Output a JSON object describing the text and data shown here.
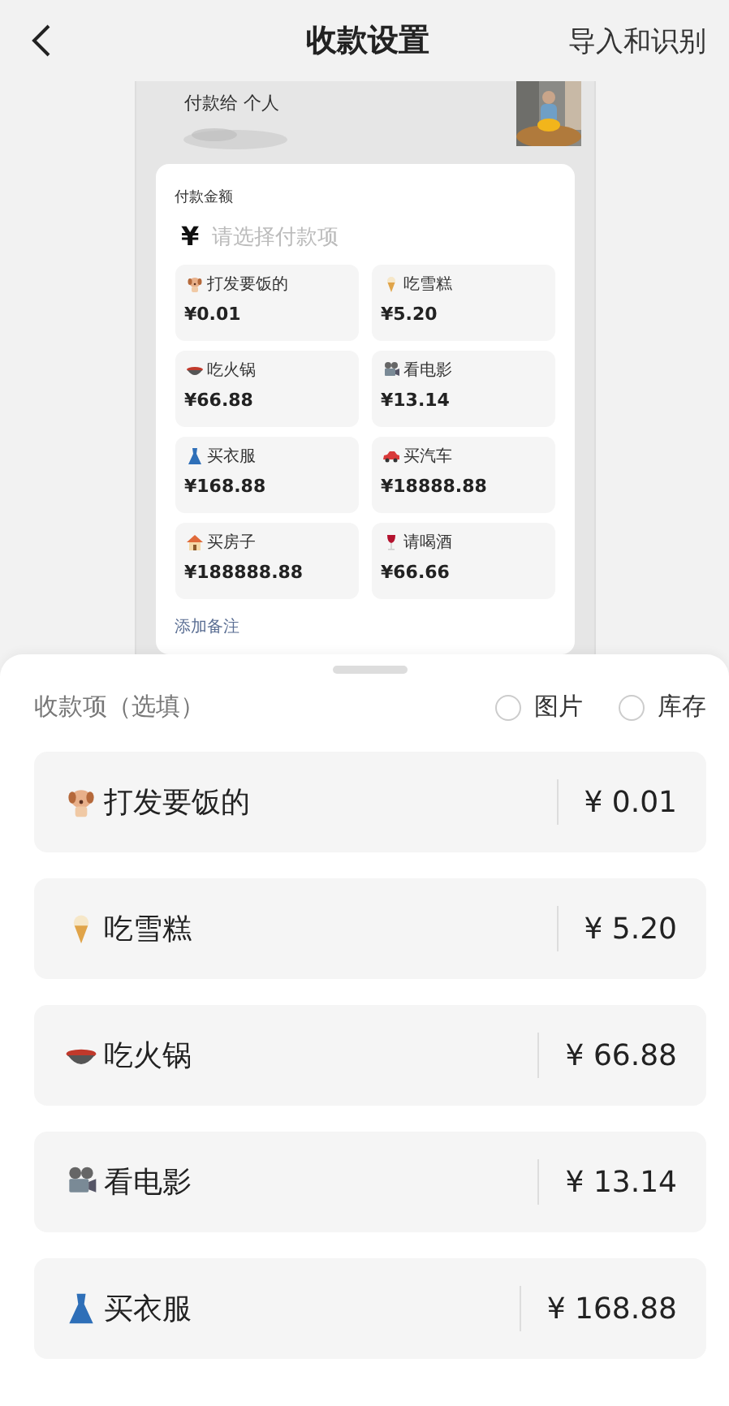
{
  "header": {
    "title": "收款设置",
    "action": "导入和识别"
  },
  "preview": {
    "payee": "付款给 个人",
    "amount_label": "付款金额",
    "currency": "¥",
    "amount_placeholder": "请选择付款项",
    "items": [
      {
        "kind": "dog",
        "name": "打发要饭的",
        "price": "¥0.01"
      },
      {
        "kind": "icecream",
        "name": "吃雪糕",
        "price": "¥5.20"
      },
      {
        "kind": "pot",
        "name": "吃火锅",
        "price": "¥66.88"
      },
      {
        "kind": "projector",
        "name": "看电影",
        "price": "¥13.14"
      },
      {
        "kind": "dress",
        "name": "买衣服",
        "price": "¥168.88"
      },
      {
        "kind": "car",
        "name": "买汽车",
        "price": "¥18888.88"
      },
      {
        "kind": "house",
        "name": "买房子",
        "price": "¥188888.88"
      },
      {
        "kind": "wine",
        "name": "请喝酒",
        "price": "¥66.66"
      }
    ],
    "add_note": "添加备注"
  },
  "sheet": {
    "title": "收款项（选填）",
    "options": [
      {
        "label": "图片",
        "checked": false
      },
      {
        "label": "库存",
        "checked": false
      }
    ],
    "items": [
      {
        "kind": "dog",
        "name": "打发要饭的",
        "price": "¥ 0.01"
      },
      {
        "kind": "icecream",
        "name": "吃雪糕",
        "price": "¥ 5.20"
      },
      {
        "kind": "pot",
        "name": "吃火锅",
        "price": "¥ 66.88"
      },
      {
        "kind": "projector",
        "name": "看电影",
        "price": "¥ 13.14"
      },
      {
        "kind": "dress",
        "name": "买衣服",
        "price": "¥ 168.88"
      }
    ]
  }
}
